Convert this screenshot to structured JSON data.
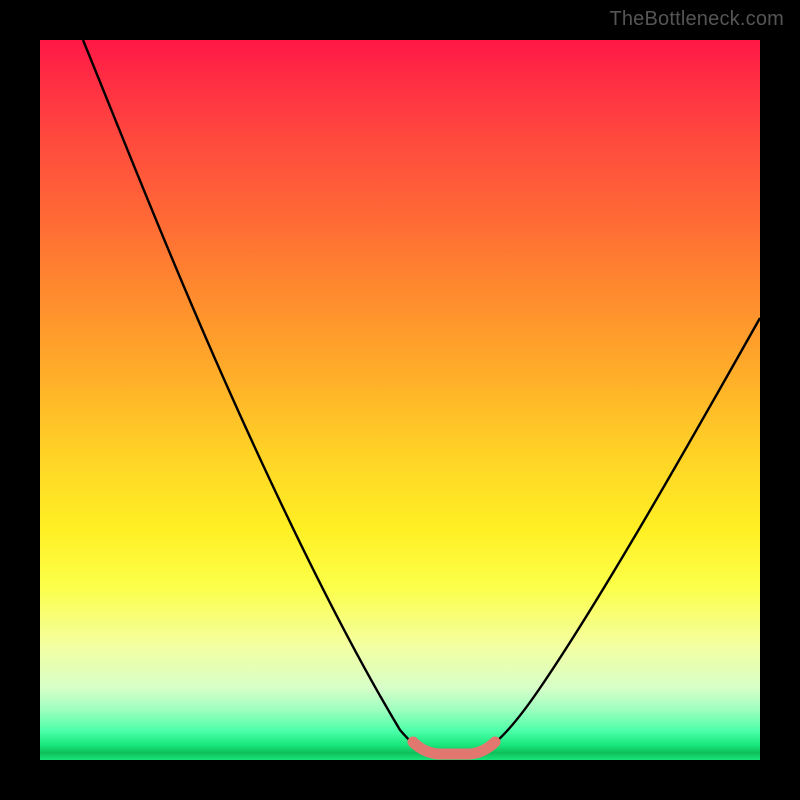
{
  "watermark": "TheBottleneck.com",
  "colors": {
    "curve": "#000000",
    "highlight": "#e2776f",
    "frame": "#000000"
  },
  "chart_data": {
    "type": "line",
    "title": "",
    "xlabel": "",
    "ylabel": "",
    "xlim": [
      0,
      100
    ],
    "ylim": [
      0,
      100
    ],
    "series": [
      {
        "name": "left-curve",
        "x": [
          6,
          10,
          15,
          20,
          25,
          30,
          35,
          40,
          45,
          47,
          49,
          51,
          53
        ],
        "y": [
          100,
          92,
          82,
          72,
          62,
          51,
          40,
          29,
          16,
          10,
          5,
          2,
          1
        ]
      },
      {
        "name": "right-curve",
        "x": [
          61,
          63,
          65,
          68,
          72,
          76,
          80,
          84,
          88,
          92,
          96,
          100
        ],
        "y": [
          1,
          2,
          4,
          8,
          15,
          22,
          29,
          36,
          43,
          50,
          56,
          62
        ]
      },
      {
        "name": "highlight-segment",
        "x": [
          51,
          53,
          55,
          57,
          59,
          61,
          63
        ],
        "y": [
          2.5,
          1.0,
          0.8,
          0.8,
          0.8,
          1.0,
          2.5
        ]
      }
    ],
    "highlight_style": {
      "stroke_width_relative": "thick",
      "rounded_caps": true
    }
  }
}
